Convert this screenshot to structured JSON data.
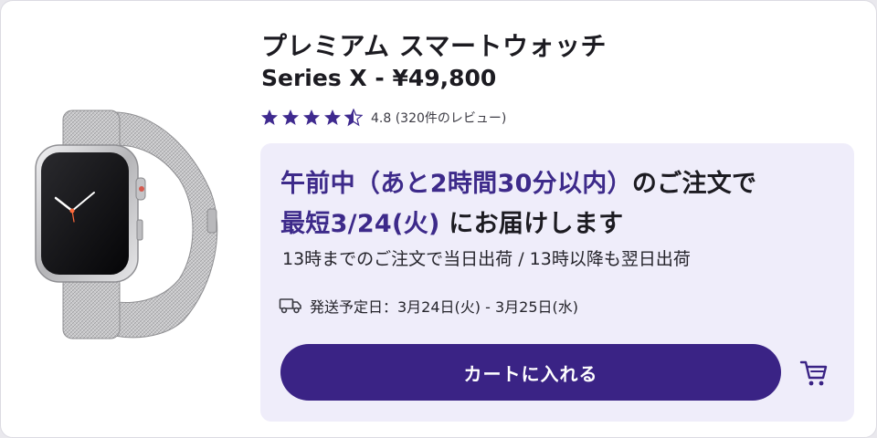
{
  "product": {
    "title": "プレミアム スマートウォッチ",
    "subtitle": "Series X - ¥49,800",
    "rating": {
      "value": 4.5,
      "max": 5,
      "label": "4.8 (320件のレビュー)"
    },
    "image_icon": "smartwatch-image"
  },
  "delivery": {
    "line1_accent": "午前中（あと2時間30分以内）",
    "line1_rest": "のご注文で",
    "line2_accent": "最短3/24(火)",
    "line2_rest": " にお届けします",
    "note": "13時までのご注文で当日出荷 / 13時以降も翌日出荷",
    "ship_icon": "truck-icon",
    "ship_label": "発送予定日：3月24日(火) - 3月25日(水)"
  },
  "actions": {
    "add_to_cart_label": "カートに入れる",
    "cart_icon": "cart-icon"
  },
  "colors": {
    "accent": "#3d2a8a",
    "button": "#3a2385",
    "panel": "#efedfa",
    "star": "#3f2a8f"
  }
}
